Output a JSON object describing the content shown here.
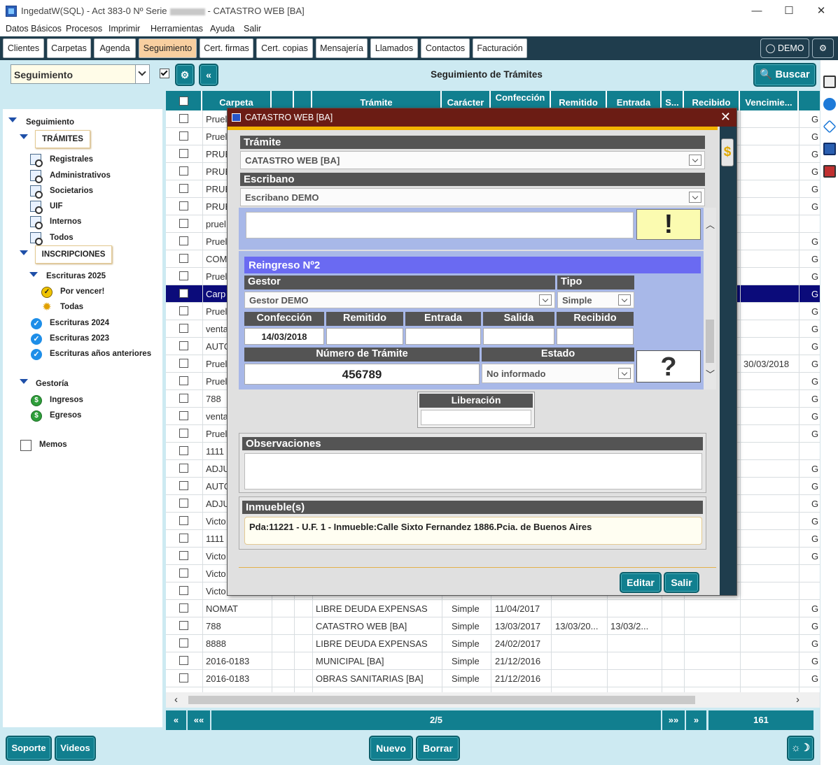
{
  "window": {
    "title_prefix": "IngedatW(SQL) - Act 383-0 Nº Serie",
    "title_suffix": "- CATASTRO WEB [BA]",
    "minimize": "—",
    "maximize": "☐",
    "close": "✕"
  },
  "menu": [
    "Datos Básicos",
    "Procesos",
    "Imprimir",
    "Herramientas",
    "Ayuda",
    "Salir"
  ],
  "toolbar": {
    "buttons": [
      "Clientes",
      "Carpetas",
      "Agenda",
      "Seguimiento",
      "Cert. firmas",
      "Cert. copias",
      "Mensajería",
      "Llamados",
      "Contactos",
      "Facturación"
    ],
    "active": "Seguimiento",
    "user": "DEMO",
    "settings_glyph": "⚙"
  },
  "filter": {
    "selected": "Seguimiento",
    "page_title": "Seguimiento de Trámites",
    "search_label": "Buscar"
  },
  "sidebar": {
    "root": "Seguimiento",
    "tramites_label": "TRÁMITES",
    "tramites_items": [
      "Registrales",
      "Administrativos",
      "Societarios",
      "UIF",
      "Internos",
      "Todos"
    ],
    "inscripciones_label": "INSCRIPCIONES",
    "escrituras_2025": "Escrituras 2025",
    "por_vencer": "Por vencer!",
    "todas": "Todas",
    "escrituras_2024": "Escrituras 2024",
    "escrituras_2023": "Escrituras 2023",
    "escrituras_anteriores": "Escrituras años anteriores",
    "gestoria": "Gestoría",
    "ingresos": "Ingresos",
    "egresos": "Egresos",
    "memos": "Memos"
  },
  "table": {
    "columns": [
      "Carpeta",
      "",
      "",
      "Trámite",
      "Carácter",
      "Confección",
      "Remitido",
      "Entrada",
      "S...",
      "Recibido",
      "Vencimie..."
    ],
    "rows": [
      {
        "carpeta": "Pruel",
        "tramite": "",
        "caracter": "",
        "confeccion": "",
        "remitido": "",
        "entrada": "",
        "vencimiento": "",
        "g": "G"
      },
      {
        "carpeta": "Pruel",
        "tramite": "",
        "caracter": "",
        "confeccion": "",
        "remitido": "",
        "entrada": "",
        "vencimiento": "",
        "g": "G"
      },
      {
        "carpeta": "PRUE",
        "tramite": "",
        "caracter": "",
        "confeccion": "",
        "remitido": "",
        "entrada": "",
        "vencimiento": "",
        "g": "G"
      },
      {
        "carpeta": "PRUE",
        "tramite": "",
        "caracter": "",
        "confeccion": "",
        "remitido": "",
        "entrada": "",
        "vencimiento": "",
        "g": "G"
      },
      {
        "carpeta": "PRUE",
        "tramite": "",
        "caracter": "",
        "confeccion": "",
        "remitido": "",
        "entrada": "",
        "vencimiento": "",
        "g": "G"
      },
      {
        "carpeta": "PRUE",
        "tramite": "",
        "caracter": "",
        "confeccion": "",
        "remitido": "",
        "entrada": "",
        "vencimiento": "",
        "g": "G"
      },
      {
        "carpeta": "pruel",
        "tramite": "",
        "caracter": "",
        "confeccion": "",
        "remitido": "",
        "entrada": "",
        "vencimiento": "",
        "g": ""
      },
      {
        "carpeta": "Pruel",
        "tramite": "",
        "caracter": "",
        "confeccion": "",
        "remitido": "",
        "entrada": "",
        "vencimiento": "",
        "g": "G"
      },
      {
        "carpeta": "COMI",
        "tramite": "",
        "caracter": "",
        "confeccion": "",
        "remitido": "",
        "entrada": "",
        "vencimiento": "",
        "g": "G"
      },
      {
        "carpeta": "Pruel",
        "tramite": "",
        "caracter": "",
        "confeccion": "",
        "remitido": "",
        "entrada": "",
        "vencimiento": "",
        "g": "G"
      },
      {
        "carpeta": "Carp",
        "tramite": "",
        "caracter": "",
        "confeccion": "",
        "remitido": "",
        "entrada": "",
        "vencimiento": "",
        "g": "G"
      },
      {
        "carpeta": "Pruel",
        "tramite": "",
        "caracter": "",
        "confeccion": "",
        "remitido": "",
        "entrada": "",
        "vencimiento": "",
        "g": "G"
      },
      {
        "carpeta": "venta",
        "tramite": "",
        "caracter": "",
        "confeccion": "",
        "remitido": "",
        "entrada": "",
        "vencimiento": "",
        "g": "G"
      },
      {
        "carpeta": "AUTO",
        "tramite": "",
        "caracter": "",
        "confeccion": "",
        "remitido": "",
        "entrada": "",
        "vencimiento": "",
        "g": "G"
      },
      {
        "carpeta": "Pruel",
        "tramite": "",
        "caracter": "",
        "confeccion": "",
        "remitido": "",
        "entrada": "",
        "vencimiento": "30/03/2018",
        "g": "G"
      },
      {
        "carpeta": "Pruel",
        "tramite": "",
        "caracter": "",
        "confeccion": "",
        "remitido": "",
        "entrada": "",
        "vencimiento": "",
        "g": "G"
      },
      {
        "carpeta": "788",
        "tramite": "",
        "caracter": "",
        "confeccion": "",
        "remitido": "",
        "entrada": "",
        "vencimiento": "",
        "g": "G"
      },
      {
        "carpeta": "venta",
        "tramite": "",
        "caracter": "",
        "confeccion": "",
        "remitido": "",
        "entrada": "",
        "vencimiento": "",
        "g": "G"
      },
      {
        "carpeta": "Pruel",
        "tramite": "",
        "caracter": "",
        "confeccion": "",
        "remitido": "",
        "entrada": "",
        "vencimiento": "",
        "g": "G"
      },
      {
        "carpeta": "1111",
        "tramite": "",
        "caracter": "",
        "confeccion": "",
        "remitido": "",
        "entrada": "",
        "vencimiento": "",
        "g": ""
      },
      {
        "carpeta": "ADJU",
        "tramite": "",
        "caracter": "",
        "confeccion": "",
        "remitido": "",
        "entrada": "",
        "vencimiento": "",
        "g": "G"
      },
      {
        "carpeta": "AUTO",
        "tramite": "",
        "caracter": "",
        "confeccion": "",
        "remitido": "",
        "entrada": "",
        "vencimiento": "",
        "g": "G"
      },
      {
        "carpeta": "ADJU",
        "tramite": "",
        "caracter": "",
        "confeccion": "",
        "remitido": "",
        "entrada": "",
        "vencimiento": "",
        "g": "G"
      },
      {
        "carpeta": "Victo",
        "tramite": "",
        "caracter": "",
        "confeccion": "",
        "remitido": "",
        "entrada": "",
        "vencimiento": "",
        "g": "G"
      },
      {
        "carpeta": "1111",
        "tramite": "",
        "caracter": "",
        "confeccion": "",
        "remitido": "",
        "entrada": "",
        "vencimiento": "",
        "g": "G"
      },
      {
        "carpeta": "Victo",
        "tramite": "",
        "caracter": "",
        "confeccion": "",
        "remitido": "",
        "entrada": "",
        "vencimiento": "",
        "g": "G"
      },
      {
        "carpeta": "Victo",
        "tramite": "",
        "caracter": "",
        "confeccion": "",
        "remitido": "",
        "entrada": "",
        "vencimiento": "",
        "g": ""
      },
      {
        "carpeta": "Victo",
        "tramite": "",
        "caracter": "",
        "confeccion": "",
        "remitido": "",
        "entrada": "",
        "vencimiento": "",
        "g": ""
      },
      {
        "carpeta": "NOMAT",
        "tramite": "LIBRE DEUDA EXPENSAS",
        "caracter": "Simple",
        "confeccion": "11/04/2017",
        "remitido": "",
        "entrada": "",
        "vencimiento": "",
        "g": "G"
      },
      {
        "carpeta": "788",
        "tramite": "CATASTRO WEB [BA]",
        "caracter": "Simple",
        "confeccion": "13/03/2017",
        "remitido": "13/03/20...",
        "entrada": "13/03/2...",
        "vencimiento": "",
        "g": "G"
      },
      {
        "carpeta": "8888",
        "tramite": "LIBRE DEUDA EXPENSAS",
        "caracter": "Simple",
        "confeccion": "24/02/2017",
        "remitido": "",
        "entrada": "",
        "vencimiento": "",
        "g": "G"
      },
      {
        "carpeta": "2016-0183",
        "tramite": "MUNICIPAL [BA]",
        "caracter": "Simple",
        "confeccion": "21/12/2016",
        "remitido": "",
        "entrada": "",
        "vencimiento": "",
        "g": "G"
      },
      {
        "carpeta": "2016-0183",
        "tramite": "OBRAS SANITARIAS [BA]",
        "caracter": "Simple",
        "confeccion": "21/12/2016",
        "remitido": "",
        "entrada": "",
        "vencimiento": "",
        "g": "G"
      }
    ]
  },
  "pager": {
    "first": "«",
    "prev": "««",
    "page": "2/5",
    "next": "»»",
    "last": "»",
    "total": "161"
  },
  "bottom": {
    "soporte": "Soporte",
    "videos": "Videos",
    "nuevo": "Nuevo",
    "borrar": "Borrar"
  },
  "modal": {
    "title": "CATASTRO WEB [BA]",
    "tramite_label": "Trámite",
    "tramite_value": "CATASTRO WEB [BA]",
    "escribano_label": "Escribano",
    "escribano_value": "Escribano DEMO",
    "alert_glyph": "!",
    "reingreso_title": "Reingreso Nº2",
    "gestor_label": "Gestor",
    "gestor_value": "Gestor DEMO",
    "tipo_label": "Tipo",
    "tipo_value": "Simple",
    "confeccion_label": "Confección",
    "confeccion_value": "14/03/2018",
    "remitido_label": "Remitido",
    "entrada_label": "Entrada",
    "salida_label": "Salida",
    "recibido_label": "Recibido",
    "numero_label": "Número de Trámite",
    "numero_value": "456789",
    "estado_label": "Estado",
    "estado_value": "No informado",
    "question_glyph": "?",
    "liberacion_label": "Liberación",
    "observaciones_label": "Observaciones",
    "inmuebles_label": "Inmueble(s)",
    "inmueble_value": "Pda:11221 - U.F. 1 - Inmueble:Calle Sixto Fernandez 1886.Pcia. de Buenos Aires",
    "editar": "Editar",
    "salir": "Salir",
    "dollar_glyph": "$"
  },
  "colors": {
    "teal": "#117f8f",
    "dark": "#1f3d4d",
    "modal_title": "#6b1c14",
    "reingreso_bg": "#a8b8e8",
    "reingreso_title": "#6666f0"
  }
}
